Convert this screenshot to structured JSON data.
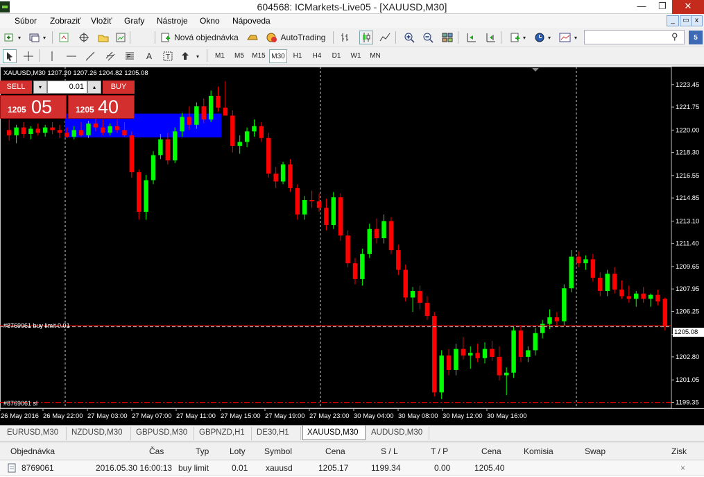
{
  "window": {
    "title": "604568: ICMarkets-Live05 - [XAUUSD,M30]",
    "minimize": "—",
    "maximize": "❐",
    "close": "✕"
  },
  "menu": {
    "items": [
      "Súbor",
      "Zobraziť",
      "Vložiť",
      "Grafy",
      "Nástroje",
      "Okno",
      "Nápoveda"
    ],
    "child_minimize": "_",
    "child_restore": "▭",
    "child_close": "x"
  },
  "toolbar": {
    "new_order_label": "Nová objednávka",
    "autotrading_label": "AutoTrading",
    "search_placeholder": "",
    "timeframes": [
      "M1",
      "M5",
      "M15",
      "M30",
      "H1",
      "H4",
      "D1",
      "W1",
      "MN"
    ],
    "active_timeframe": "M30",
    "drawing_tools": [
      "cursor",
      "crosshair",
      "vertical-line",
      "horizontal-line",
      "trend-line",
      "channel",
      "fibonacci",
      "text",
      "label"
    ]
  },
  "chart": {
    "symbol_info": "XAUUSD,M30  1207.20 1207.26 1204.82 1205.08",
    "sell_label": "SELL",
    "buy_label": "BUY",
    "lot_value": "0.01",
    "sell_price_big": "05",
    "sell_price_small": "1205",
    "buy_price_big": "40",
    "buy_price_small": "1205",
    "buy_limit_label": "#8769061 buy limit 0.01",
    "sl_label": "#8769061 sl",
    "current_price": "1205.08",
    "colors": {
      "bull": "#00ff00",
      "bear": "#ff0000",
      "background": "#000000",
      "grid": "#c0c0c0",
      "buy_limit_line": "#ff0000",
      "sl_line": "#ff0000",
      "volume_rect": "#0000ff"
    }
  },
  "chart_data": {
    "type": "candlestick",
    "y_ticks": [
      "1223.45",
      "1221.75",
      "1220.00",
      "1218.30",
      "1216.55",
      "1214.85",
      "1213.10",
      "1211.40",
      "1209.65",
      "1207.95",
      "1206.25",
      "1204.50",
      "1202.80",
      "1201.05",
      "1199.35"
    ],
    "x_ticks": [
      "26 May 2016",
      "26 May 22:00",
      "27 May 03:00",
      "27 May 07:00",
      "27 May 11:00",
      "27 May 15:00",
      "27 May 19:00",
      "27 May 23:00",
      "30 May 04:00",
      "30 May 08:00",
      "30 May 12:00",
      "30 May 16:00"
    ],
    "ylim": [
      1198.9,
      1224.6
    ],
    "buy_limit_price": 1205.17,
    "sl_price": 1199.34,
    "bid": 1205.08,
    "candles": [
      [
        1220.0,
        1220.8,
        1219.2,
        1219.6
      ],
      [
        1219.6,
        1220.4,
        1219.0,
        1220.2
      ],
      [
        1220.2,
        1220.6,
        1219.4,
        1219.7
      ],
      [
        1219.7,
        1220.3,
        1219.3,
        1220.1
      ],
      [
        1220.1,
        1220.5,
        1219.6,
        1219.8
      ],
      [
        1219.8,
        1220.4,
        1219.5,
        1220.2
      ],
      [
        1220.2,
        1220.6,
        1219.7,
        1220.0
      ],
      [
        1220.0,
        1220.4,
        1219.4,
        1219.8
      ],
      [
        1219.8,
        1220.2,
        1219.4,
        1219.5
      ],
      [
        1219.5,
        1220.3,
        1219.3,
        1220.0
      ],
      [
        1220.0,
        1220.6,
        1219.5,
        1219.6
      ],
      [
        1219.6,
        1220.7,
        1219.4,
        1220.5
      ],
      [
        1220.5,
        1220.9,
        1219.9,
        1220.2
      ],
      [
        1220.2,
        1220.8,
        1219.6,
        1219.8
      ],
      [
        1219.8,
        1220.5,
        1219.6,
        1220.3
      ],
      [
        1220.3,
        1220.8,
        1219.8,
        1220.0
      ],
      [
        1220.0,
        1220.6,
        1219.5,
        1219.6
      ],
      [
        1219.6,
        1219.9,
        1216.4,
        1216.8
      ],
      [
        1216.8,
        1217.0,
        1213.2,
        1213.8
      ],
      [
        1213.8,
        1216.6,
        1213.2,
        1216.2
      ],
      [
        1216.2,
        1218.4,
        1215.9,
        1218.1
      ],
      [
        1218.1,
        1219.7,
        1217.8,
        1219.3
      ],
      [
        1219.3,
        1219.8,
        1217.4,
        1217.7
      ],
      [
        1217.7,
        1220.2,
        1217.5,
        1219.9
      ],
      [
        1219.9,
        1221.3,
        1219.5,
        1221.0
      ],
      [
        1221.0,
        1221.8,
        1220.0,
        1220.4
      ],
      [
        1220.4,
        1222.1,
        1220.1,
        1221.8
      ],
      [
        1221.8,
        1222.4,
        1220.5,
        1220.8
      ],
      [
        1220.8,
        1223.0,
        1220.6,
        1222.6
      ],
      [
        1222.6,
        1223.3,
        1221.4,
        1221.7
      ],
      [
        1221.7,
        1223.7,
        1221.3,
        1221.1
      ],
      [
        1221.1,
        1221.5,
        1218.3,
        1218.8
      ],
      [
        1218.8,
        1219.6,
        1218.2,
        1219.1
      ],
      [
        1219.1,
        1220.2,
        1218.7,
        1219.9
      ],
      [
        1219.9,
        1220.8,
        1219.5,
        1220.3
      ],
      [
        1220.3,
        1220.6,
        1219.1,
        1219.4
      ],
      [
        1219.4,
        1219.8,
        1216.4,
        1216.7
      ],
      [
        1216.7,
        1217.2,
        1215.6,
        1216.1
      ],
      [
        1216.1,
        1217.6,
        1215.9,
        1217.4
      ],
      [
        1217.4,
        1217.8,
        1215.3,
        1215.6
      ],
      [
        1215.6,
        1215.9,
        1213.2,
        1213.6
      ],
      [
        1213.6,
        1215.0,
        1213.2,
        1214.7
      ],
      [
        1214.7,
        1215.4,
        1214.1,
        1214.6
      ],
      [
        1214.6,
        1215.2,
        1213.8,
        1214.1
      ],
      [
        1214.1,
        1214.8,
        1212.4,
        1212.8
      ],
      [
        1212.8,
        1215.3,
        1212.5,
        1214.9
      ],
      [
        1214.9,
        1215.2,
        1211.6,
        1212.0
      ],
      [
        1212.0,
        1212.4,
        1209.6,
        1209.9
      ],
      [
        1209.9,
        1210.3,
        1208.3,
        1208.7
      ],
      [
        1208.7,
        1211.0,
        1208.2,
        1210.6
      ],
      [
        1210.6,
        1212.9,
        1210.3,
        1212.5
      ],
      [
        1212.5,
        1213.3,
        1211.4,
        1211.8
      ],
      [
        1211.8,
        1213.6,
        1211.4,
        1213.1
      ],
      [
        1213.1,
        1213.4,
        1210.6,
        1210.9
      ],
      [
        1210.9,
        1211.3,
        1209.0,
        1209.4
      ],
      [
        1209.4,
        1209.8,
        1207.0,
        1207.3
      ],
      [
        1207.3,
        1208.1,
        1206.2,
        1207.8
      ],
      [
        1207.8,
        1208.2,
        1206.4,
        1206.9
      ],
      [
        1206.9,
        1207.4,
        1205.6,
        1205.9
      ],
      [
        1205.9,
        1206.2,
        1199.8,
        1200.1
      ],
      [
        1200.1,
        1203.3,
        1199.6,
        1202.9
      ],
      [
        1202.9,
        1203.4,
        1201.4,
        1201.8
      ],
      [
        1201.8,
        1203.8,
        1201.4,
        1203.4
      ],
      [
        1203.4,
        1204.3,
        1202.6,
        1202.9
      ],
      [
        1202.9,
        1203.6,
        1201.9,
        1203.1
      ],
      [
        1203.1,
        1203.8,
        1202.4,
        1202.7
      ],
      [
        1202.7,
        1203.9,
        1202.3,
        1203.4
      ],
      [
        1203.4,
        1204.0,
        1202.5,
        1202.8
      ],
      [
        1202.8,
        1203.6,
        1201.0,
        1201.4
      ],
      [
        1201.4,
        1202.0,
        1199.9,
        1201.6
      ],
      [
        1201.6,
        1205.1,
        1201.2,
        1204.8
      ],
      [
        1204.8,
        1205.2,
        1202.4,
        1202.8
      ],
      [
        1202.8,
        1203.6,
        1202.4,
        1203.3
      ],
      [
        1203.3,
        1205.0,
        1202.9,
        1204.6
      ],
      [
        1204.6,
        1205.6,
        1204.2,
        1205.3
      ],
      [
        1205.3,
        1206.4,
        1204.9,
        1205.8
      ],
      [
        1205.8,
        1206.2,
        1205.1,
        1205.5
      ],
      [
        1205.5,
        1208.3,
        1205.2,
        1208.0
      ],
      [
        1208.0,
        1210.9,
        1207.7,
        1210.4
      ],
      [
        1210.4,
        1210.8,
        1209.6,
        1209.9
      ],
      [
        1209.9,
        1210.5,
        1209.4,
        1210.2
      ],
      [
        1210.2,
        1210.6,
        1208.5,
        1208.8
      ],
      [
        1208.8,
        1209.2,
        1207.4,
        1207.8
      ],
      [
        1207.8,
        1209.4,
        1207.4,
        1209.1
      ],
      [
        1209.1,
        1209.6,
        1207.6,
        1207.9
      ],
      [
        1207.9,
        1208.6,
        1207.2,
        1207.4
      ],
      [
        1207.4,
        1208.2,
        1206.9,
        1207.2
      ],
      [
        1207.2,
        1207.8,
        1206.6,
        1207.6
      ],
      [
        1207.6,
        1208.1,
        1206.9,
        1207.2
      ],
      [
        1207.2,
        1207.6,
        1206.6,
        1207.5
      ],
      [
        1207.5,
        1207.9,
        1206.7,
        1207.0
      ],
      [
        1207.2,
        1207.3,
        1204.8,
        1205.1
      ]
    ]
  },
  "tabs": {
    "items": [
      "EURUSD,M30",
      "NZDUSD,M30",
      "GBPUSD,M30",
      "GBPNZD,H1",
      "DE30,H1",
      "XAUUSD,M30",
      "AUDUSD,M30"
    ],
    "active": "XAUUSD,M30"
  },
  "terminal": {
    "headers": [
      "Objednávka",
      "Čas",
      "Typ",
      "Loty",
      "Symbol",
      "Cena",
      "S / L",
      "T / P",
      "Cena",
      "Komisia",
      "Swap",
      "Zisk"
    ],
    "row": {
      "order": "8769061",
      "time": "2016.05.30 16:00:13",
      "type": "buy limit",
      "lots": "0.01",
      "symbol": "xauusd",
      "price": "1205.17",
      "sl": "1199.34",
      "tp": "0.00",
      "current": "1205.40",
      "close": "×"
    }
  }
}
